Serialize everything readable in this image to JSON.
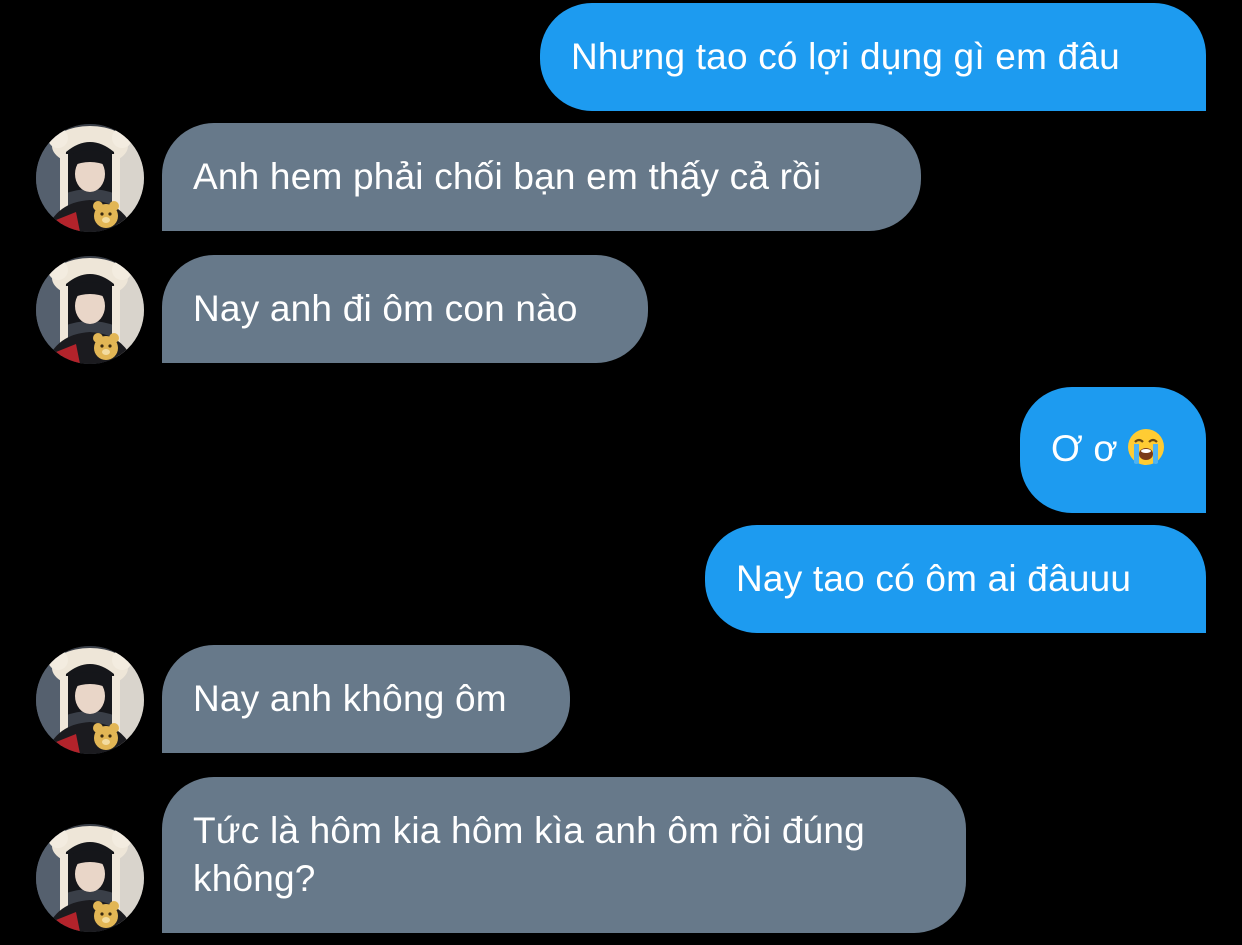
{
  "messages": [
    {
      "side": "outgoing",
      "text": "Nhưng tao có lợi dụng gì em đâu"
    },
    {
      "side": "incoming",
      "text": "Anh hem phải chối bạn em thấy cả rồi"
    },
    {
      "side": "incoming",
      "text": "Nay anh đi ôm con nào"
    },
    {
      "side": "outgoing",
      "text": "Ơ ơ",
      "emoji": "loudly-crying-face-icon"
    },
    {
      "side": "outgoing",
      "text": "Nay tao có ôm ai đâuuu"
    },
    {
      "side": "incoming",
      "text": "Nay anh không ôm"
    },
    {
      "side": "incoming",
      "text": "Tức là hôm kia hôm kìa anh ôm rồi đúng không?"
    }
  ],
  "colors": {
    "background": "#000000",
    "outgoing_bubble": "#1d9bf0",
    "incoming_bubble": "#67798a",
    "text": "#ffffff"
  }
}
